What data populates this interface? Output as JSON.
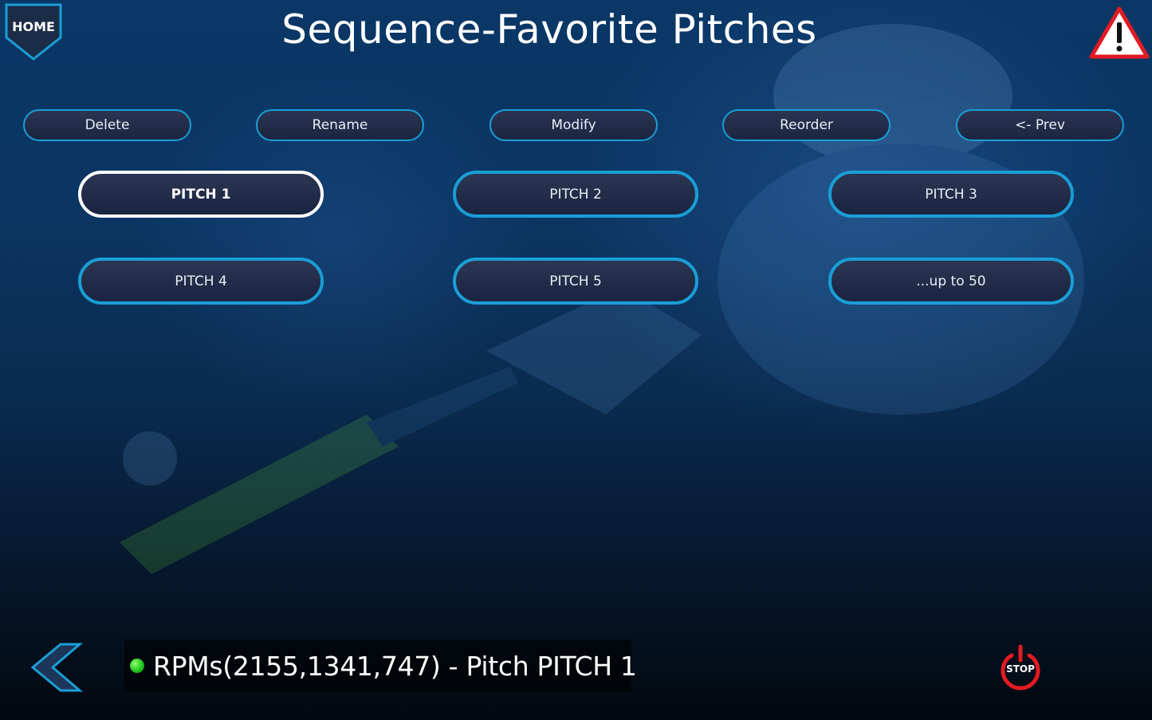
{
  "header": {
    "home_label": "HOME",
    "title": "Sequence-Favorite Pitches",
    "warning_icon": "warning-triangle-icon"
  },
  "actions": [
    {
      "label": "Delete"
    },
    {
      "label": "Rename"
    },
    {
      "label": "Modify"
    },
    {
      "label": "Reorder"
    },
    {
      "label": "<- Prev"
    }
  ],
  "pitches": [
    {
      "label": "PITCH 1",
      "selected": true
    },
    {
      "label": "PITCH 2",
      "selected": false
    },
    {
      "label": "PITCH 3",
      "selected": false
    },
    {
      "label": "PITCH 4",
      "selected": false
    },
    {
      "label": "PITCH 5",
      "selected": false
    },
    {
      "label": "...up to 50",
      "selected": false
    }
  ],
  "footer": {
    "back_icon": "chevron-left-icon",
    "status_text": "RPMs(2155,1341,747) - Pitch PITCH 1",
    "status_indicator_color": "#22c322",
    "stop_label": "STOP"
  },
  "colors": {
    "accent": "#1a9ed6",
    "selected_border": "#ffffff",
    "warning_red": "#e31b23",
    "stop_red": "#e31b23"
  }
}
